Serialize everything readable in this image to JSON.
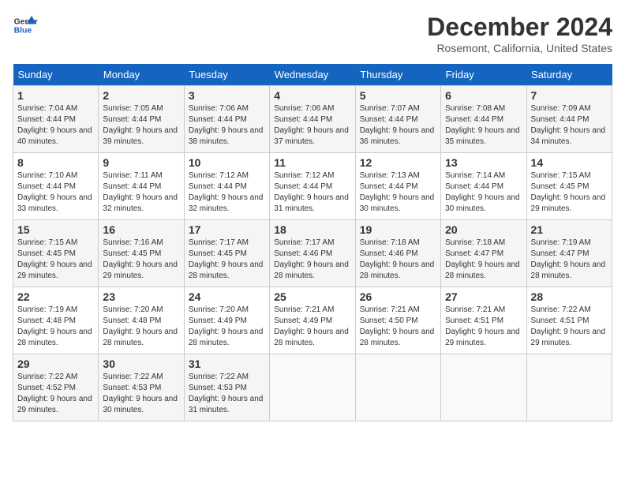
{
  "header": {
    "logo_line1": "General",
    "logo_line2": "Blue",
    "month_title": "December 2024",
    "location": "Rosemont, California, United States"
  },
  "weekdays": [
    "Sunday",
    "Monday",
    "Tuesday",
    "Wednesday",
    "Thursday",
    "Friday",
    "Saturday"
  ],
  "weeks": [
    [
      {
        "day": "1",
        "sunrise": "Sunrise: 7:04 AM",
        "sunset": "Sunset: 4:44 PM",
        "daylight": "Daylight: 9 hours and 40 minutes."
      },
      {
        "day": "2",
        "sunrise": "Sunrise: 7:05 AM",
        "sunset": "Sunset: 4:44 PM",
        "daylight": "Daylight: 9 hours and 39 minutes."
      },
      {
        "day": "3",
        "sunrise": "Sunrise: 7:06 AM",
        "sunset": "Sunset: 4:44 PM",
        "daylight": "Daylight: 9 hours and 38 minutes."
      },
      {
        "day": "4",
        "sunrise": "Sunrise: 7:06 AM",
        "sunset": "Sunset: 4:44 PM",
        "daylight": "Daylight: 9 hours and 37 minutes."
      },
      {
        "day": "5",
        "sunrise": "Sunrise: 7:07 AM",
        "sunset": "Sunset: 4:44 PM",
        "daylight": "Daylight: 9 hours and 36 minutes."
      },
      {
        "day": "6",
        "sunrise": "Sunrise: 7:08 AM",
        "sunset": "Sunset: 4:44 PM",
        "daylight": "Daylight: 9 hours and 35 minutes."
      },
      {
        "day": "7",
        "sunrise": "Sunrise: 7:09 AM",
        "sunset": "Sunset: 4:44 PM",
        "daylight": "Daylight: 9 hours and 34 minutes."
      }
    ],
    [
      {
        "day": "8",
        "sunrise": "Sunrise: 7:10 AM",
        "sunset": "Sunset: 4:44 PM",
        "daylight": "Daylight: 9 hours and 33 minutes."
      },
      {
        "day": "9",
        "sunrise": "Sunrise: 7:11 AM",
        "sunset": "Sunset: 4:44 PM",
        "daylight": "Daylight: 9 hours and 32 minutes."
      },
      {
        "day": "10",
        "sunrise": "Sunrise: 7:12 AM",
        "sunset": "Sunset: 4:44 PM",
        "daylight": "Daylight: 9 hours and 32 minutes."
      },
      {
        "day": "11",
        "sunrise": "Sunrise: 7:12 AM",
        "sunset": "Sunset: 4:44 PM",
        "daylight": "Daylight: 9 hours and 31 minutes."
      },
      {
        "day": "12",
        "sunrise": "Sunrise: 7:13 AM",
        "sunset": "Sunset: 4:44 PM",
        "daylight": "Daylight: 9 hours and 30 minutes."
      },
      {
        "day": "13",
        "sunrise": "Sunrise: 7:14 AM",
        "sunset": "Sunset: 4:44 PM",
        "daylight": "Daylight: 9 hours and 30 minutes."
      },
      {
        "day": "14",
        "sunrise": "Sunrise: 7:15 AM",
        "sunset": "Sunset: 4:45 PM",
        "daylight": "Daylight: 9 hours and 29 minutes."
      }
    ],
    [
      {
        "day": "15",
        "sunrise": "Sunrise: 7:15 AM",
        "sunset": "Sunset: 4:45 PM",
        "daylight": "Daylight: 9 hours and 29 minutes."
      },
      {
        "day": "16",
        "sunrise": "Sunrise: 7:16 AM",
        "sunset": "Sunset: 4:45 PM",
        "daylight": "Daylight: 9 hours and 29 minutes."
      },
      {
        "day": "17",
        "sunrise": "Sunrise: 7:17 AM",
        "sunset": "Sunset: 4:45 PM",
        "daylight": "Daylight: 9 hours and 28 minutes."
      },
      {
        "day": "18",
        "sunrise": "Sunrise: 7:17 AM",
        "sunset": "Sunset: 4:46 PM",
        "daylight": "Daylight: 9 hours and 28 minutes."
      },
      {
        "day": "19",
        "sunrise": "Sunrise: 7:18 AM",
        "sunset": "Sunset: 4:46 PM",
        "daylight": "Daylight: 9 hours and 28 minutes."
      },
      {
        "day": "20",
        "sunrise": "Sunrise: 7:18 AM",
        "sunset": "Sunset: 4:47 PM",
        "daylight": "Daylight: 9 hours and 28 minutes."
      },
      {
        "day": "21",
        "sunrise": "Sunrise: 7:19 AM",
        "sunset": "Sunset: 4:47 PM",
        "daylight": "Daylight: 9 hours and 28 minutes."
      }
    ],
    [
      {
        "day": "22",
        "sunrise": "Sunrise: 7:19 AM",
        "sunset": "Sunset: 4:48 PM",
        "daylight": "Daylight: 9 hours and 28 minutes."
      },
      {
        "day": "23",
        "sunrise": "Sunrise: 7:20 AM",
        "sunset": "Sunset: 4:48 PM",
        "daylight": "Daylight: 9 hours and 28 minutes."
      },
      {
        "day": "24",
        "sunrise": "Sunrise: 7:20 AM",
        "sunset": "Sunset: 4:49 PM",
        "daylight": "Daylight: 9 hours and 28 minutes."
      },
      {
        "day": "25",
        "sunrise": "Sunrise: 7:21 AM",
        "sunset": "Sunset: 4:49 PM",
        "daylight": "Daylight: 9 hours and 28 minutes."
      },
      {
        "day": "26",
        "sunrise": "Sunrise: 7:21 AM",
        "sunset": "Sunset: 4:50 PM",
        "daylight": "Daylight: 9 hours and 28 minutes."
      },
      {
        "day": "27",
        "sunrise": "Sunrise: 7:21 AM",
        "sunset": "Sunset: 4:51 PM",
        "daylight": "Daylight: 9 hours and 29 minutes."
      },
      {
        "day": "28",
        "sunrise": "Sunrise: 7:22 AM",
        "sunset": "Sunset: 4:51 PM",
        "daylight": "Daylight: 9 hours and 29 minutes."
      }
    ],
    [
      {
        "day": "29",
        "sunrise": "Sunrise: 7:22 AM",
        "sunset": "Sunset: 4:52 PM",
        "daylight": "Daylight: 9 hours and 29 minutes."
      },
      {
        "day": "30",
        "sunrise": "Sunrise: 7:22 AM",
        "sunset": "Sunset: 4:53 PM",
        "daylight": "Daylight: 9 hours and 30 minutes."
      },
      {
        "day": "31",
        "sunrise": "Sunrise: 7:22 AM",
        "sunset": "Sunset: 4:53 PM",
        "daylight": "Daylight: 9 hours and 31 minutes."
      },
      null,
      null,
      null,
      null
    ]
  ]
}
